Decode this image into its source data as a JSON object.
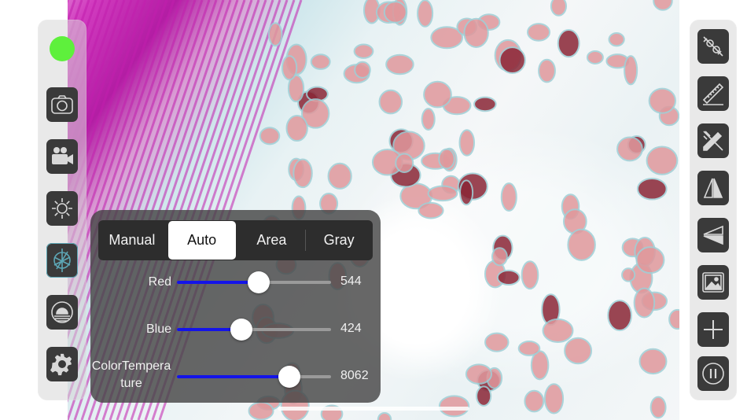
{
  "status": {
    "connected_color": "#5ef03c"
  },
  "left_toolbar": [
    {
      "icon": "camera-icon"
    },
    {
      "icon": "video-camera-icon"
    },
    {
      "icon": "brightness-icon"
    },
    {
      "icon": "white-balance-icon",
      "active": true
    },
    {
      "icon": "exposure-icon"
    },
    {
      "icon": "gear-icon"
    }
  ],
  "right_toolbar": [
    {
      "icon": "calibration-icon"
    },
    {
      "icon": "ruler-icon"
    },
    {
      "icon": "pencil-ruler-icon"
    },
    {
      "icon": "flip-horizontal-icon"
    },
    {
      "icon": "flip-vertical-icon"
    },
    {
      "icon": "gallery-icon"
    },
    {
      "icon": "plus-icon"
    },
    {
      "icon": "pause-icon"
    }
  ],
  "white_balance": {
    "modes": [
      "Manual",
      "Auto",
      "Area",
      "Gray"
    ],
    "selected_mode": "Auto",
    "sliders": [
      {
        "label": "Red",
        "value": "544",
        "fraction": 0.53
      },
      {
        "label": "Blue",
        "value": "424",
        "fraction": 0.42
      },
      {
        "label_line1": "ColorTempera",
        "label_line2": "ture",
        "value": "8062",
        "fraction": 0.73
      }
    ],
    "accent_color": "#1414e8"
  }
}
